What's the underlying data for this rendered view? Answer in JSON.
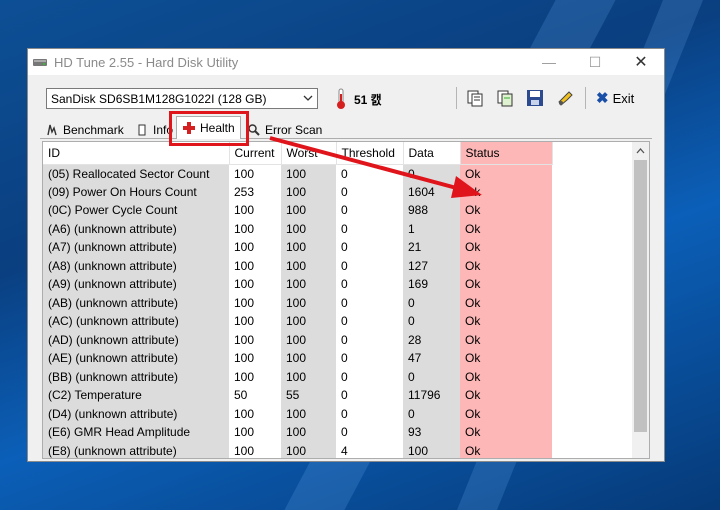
{
  "window": {
    "title": "HD Tune 2.55 - Hard Disk Utility",
    "minimize_glyph": "—",
    "maximize_glyph": "☐",
    "close_glyph": "✕"
  },
  "toolbar": {
    "drive": "SanDisk SD6SB1M128G1022I (128 GB)",
    "temperature": "51 캜",
    "exit_label": "Exit",
    "exit_glyph": "✖"
  },
  "tabs": [
    {
      "label": "Benchmark",
      "icon": "benchmark-icon"
    },
    {
      "label": "Info",
      "icon": "info-icon"
    },
    {
      "label": "Health",
      "icon": "health-cross-icon",
      "active": true
    },
    {
      "label": "Error Scan",
      "icon": "magnifier-icon"
    }
  ],
  "table": {
    "columns": [
      "ID",
      "Current",
      "Worst",
      "Threshold",
      "Data",
      "Status"
    ],
    "rows": [
      [
        "(05) Reallocated Sector Count",
        "100",
        "100",
        "0",
        "0",
        "Ok"
      ],
      [
        "(09) Power On Hours Count",
        "253",
        "100",
        "0",
        "1604",
        "Ok"
      ],
      [
        "(0C) Power Cycle Count",
        "100",
        "100",
        "0",
        "988",
        "Ok"
      ],
      [
        "(A6) (unknown attribute)",
        "100",
        "100",
        "0",
        "1",
        "Ok"
      ],
      [
        "(A7) (unknown attribute)",
        "100",
        "100",
        "0",
        "21",
        "Ok"
      ],
      [
        "(A8) (unknown attribute)",
        "100",
        "100",
        "0",
        "127",
        "Ok"
      ],
      [
        "(A9) (unknown attribute)",
        "100",
        "100",
        "0",
        "169",
        "Ok"
      ],
      [
        "(AB) (unknown attribute)",
        "100",
        "100",
        "0",
        "0",
        "Ok"
      ],
      [
        "(AC) (unknown attribute)",
        "100",
        "100",
        "0",
        "0",
        "Ok"
      ],
      [
        "(AD) (unknown attribute)",
        "100",
        "100",
        "0",
        "28",
        "Ok"
      ],
      [
        "(AE) (unknown attribute)",
        "100",
        "100",
        "0",
        "47",
        "Ok"
      ],
      [
        "(BB) (unknown attribute)",
        "100",
        "100",
        "0",
        "0",
        "Ok"
      ],
      [
        "(C2) Temperature",
        "50",
        "55",
        "0",
        "11796",
        "Ok"
      ],
      [
        "(D4) (unknown attribute)",
        "100",
        "100",
        "0",
        "0",
        "Ok"
      ],
      [
        "(E6) GMR Head Amplitude",
        "100",
        "100",
        "0",
        "93",
        "Ok"
      ],
      [
        "(E8) (unknown attribute)",
        "100",
        "100",
        "4",
        "100",
        "Ok"
      ]
    ]
  },
  "colors": {
    "status_column": "#fdb7b7",
    "annotation_red": "#e0151c",
    "shaded_column": "#dcdcdc"
  }
}
